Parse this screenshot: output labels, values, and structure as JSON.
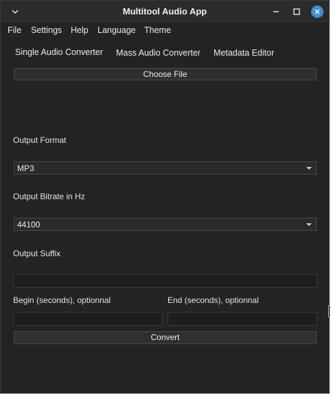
{
  "window": {
    "title": "Multitool Audio App"
  },
  "icons": {
    "menu": "chevron-down-icon",
    "minimize": "minimize-icon",
    "maximize": "maximize-icon",
    "close": "close-icon"
  },
  "colors": {
    "close_button": "#3d8fd6",
    "background": "#232323"
  },
  "menubar": {
    "file": "File",
    "settings": "Settings",
    "help": "Help",
    "language": "Language",
    "theme": "Theme"
  },
  "tabs": {
    "single": "Single Audio Converter",
    "mass": "Mass Audio Converter",
    "metadata": "Metadata Editor"
  },
  "form": {
    "choose_file": "Choose File",
    "output_format_label": "Output Format",
    "output_format_value": "MP3",
    "bitrate_label": "Output Bitrate in Hz",
    "bitrate_value": "44100",
    "suffix_label": "Output Suffix",
    "suffix_value": "",
    "begin_label": "Begin (seconds), optionnal",
    "begin_value": "",
    "end_label": "End (seconds), optionnal",
    "end_value": "",
    "convert": "Convert"
  }
}
